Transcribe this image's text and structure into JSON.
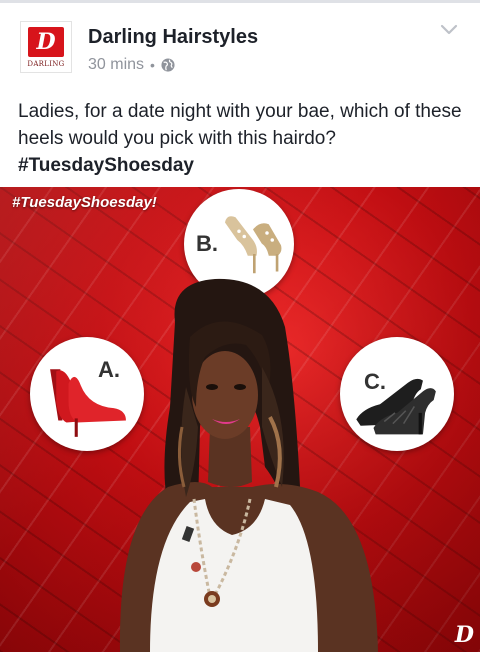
{
  "post": {
    "page_name": "Darling Hairstyles",
    "time": "30 mins",
    "separator": "•",
    "privacy_icon": "globe-icon",
    "menu_icon": "chevron-down-icon",
    "avatar": {
      "mark": "D",
      "word": "DARLING",
      "brand_color": "#d7141b"
    },
    "text": "Ladies, for a date night with your bae, which of these heels would you pick with this hairdo?",
    "hashtag": "#TuesdayShoesday"
  },
  "photo": {
    "tag": "#TuesdayShoesday!",
    "options": [
      {
        "letter": "A.",
        "shoe": "red suede pumps",
        "color": "#c8161c"
      },
      {
        "letter": "B.",
        "shoe": "gold studded pumps",
        "color": "#d8c19a"
      },
      {
        "letter": "C.",
        "shoe": "black quilted pumps",
        "color": "#1e1e1e"
      }
    ],
    "corner_mark": "D"
  }
}
